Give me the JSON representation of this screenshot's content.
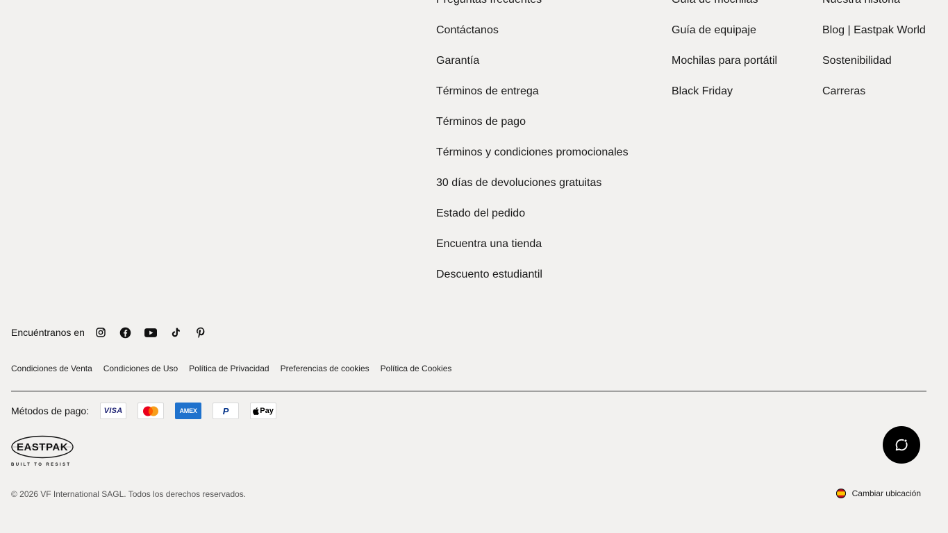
{
  "footer": {
    "help_links": [
      "Preguntas frecuentes",
      "Contáctanos",
      "Garantía",
      "Términos de entrega",
      "Términos de pago",
      "Términos y condiciones promocionales",
      "30 días de devoluciones gratuitas",
      "Estado del pedido",
      "Encuentra una tienda",
      "Descuento estudiantil"
    ],
    "shop_links": [
      "Guía de mochilas",
      "Guía de equipaje",
      "Mochilas para portátil",
      "Black Friday"
    ],
    "about_links": [
      "Nuestra historia",
      "Blog | Eastpak World",
      "Sostenibilidad",
      "Carreras"
    ]
  },
  "social": {
    "label": "Encuéntranos en",
    "icons": [
      "instagram-icon",
      "facebook-icon",
      "youtube-icon",
      "tiktok-icon",
      "pinterest-icon"
    ]
  },
  "legal_links": [
    "Condiciones de Venta",
    "Condiciones de Uso",
    "Política de Privacidad",
    "Preferencias de cookies",
    "Política de Cookies"
  ],
  "payments": {
    "label": "Métodos de pago:",
    "methods": [
      {
        "name": "visa",
        "text": "VISA"
      },
      {
        "name": "mastercard",
        "text": ""
      },
      {
        "name": "amex",
        "text": "AMEX"
      },
      {
        "name": "paypal",
        "text": "P"
      },
      {
        "name": "applepay",
        "text": "Pay"
      }
    ]
  },
  "logo": {
    "brand": "EASTPAK",
    "tagline": "BUILT TO RESIST"
  },
  "copyright": "© 2026 VF International SAGL. Todos los derechos reservados.",
  "location": {
    "label": "Cambiar ubicación",
    "flag_icon": "spain-flag-icon"
  },
  "chat": {
    "icon": "chat-icon"
  },
  "colors": {
    "background": "#f2f1ef",
    "text": "#111111",
    "amex": "#1f72cd",
    "visa": "#1a1f71",
    "paypal": "#003087",
    "chat_bg": "#000000"
  }
}
